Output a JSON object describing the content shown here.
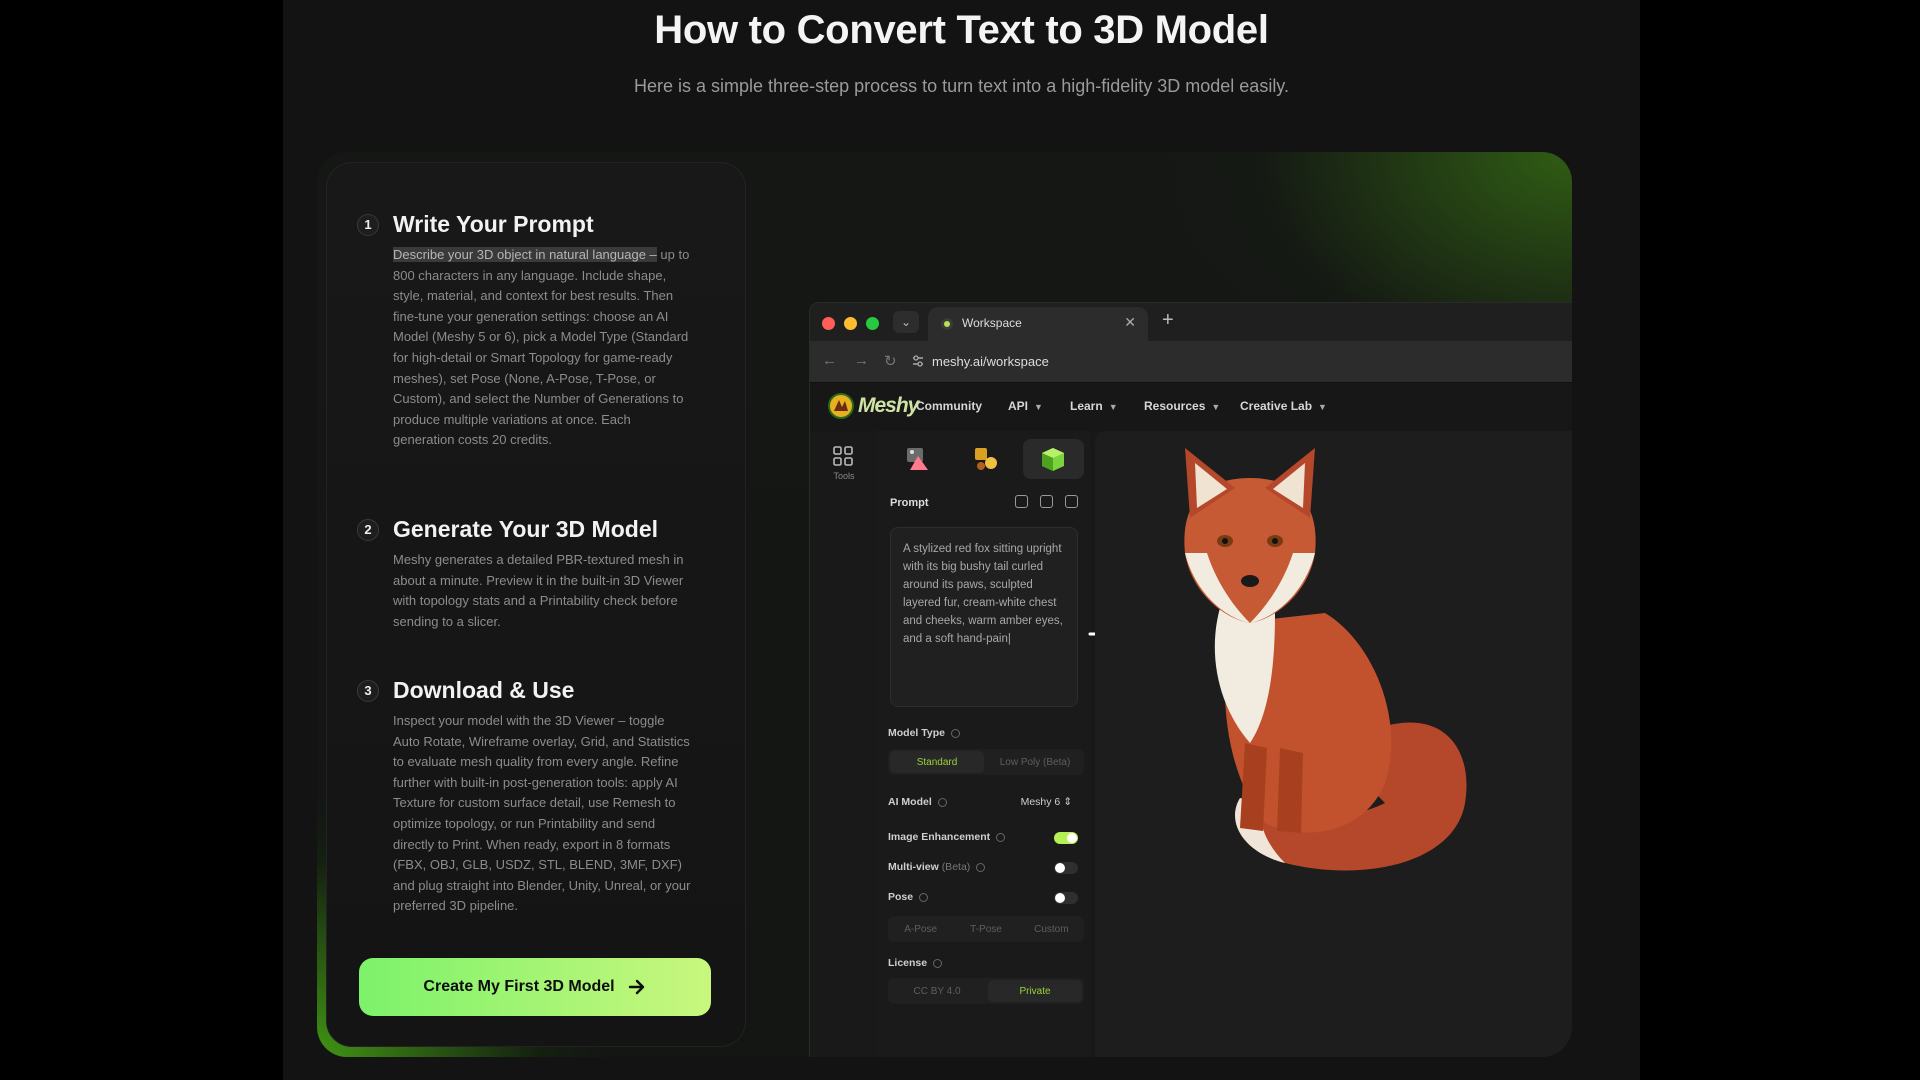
{
  "header": {
    "title": "How to Convert Text to 3D Model",
    "subtitle": "Here is a simple three-step process to turn text into a high-fidelity 3D model easily."
  },
  "steps": [
    {
      "number": "1",
      "title": "Write Your Prompt",
      "desc_highlight": "Describe your 3D object in natural language –",
      "desc": " up to 800 characters in any language. Include shape, style, material, and context for best results. Then fine-tune your generation settings: choose an AI Model (Meshy 5 or 6), pick a Model Type (Standard for high-detail or Smart Topology for game-ready meshes), set Pose (None, A-Pose, T-Pose, or Custom), and select the Number of Generations to produce multiple variations at once. Each generation costs 20 credits."
    },
    {
      "number": "2",
      "title": "Generate Your 3D Model",
      "desc": "Meshy generates a detailed PBR-textured mesh in about a minute. Preview it in the built-in 3D Viewer with topology stats and a Printability check before sending to a slicer."
    },
    {
      "number": "3",
      "title": "Download & Use",
      "desc": "Inspect your model with the 3D Viewer – toggle Auto Rotate, Wireframe overlay, Grid, and Statistics to evaluate mesh quality from every angle. Refine further with built-in post-generation tools: apply AI Texture for custom surface detail, use Remesh to optimize topology, or run Printability and send directly to Print. When ready, export in 8 formats (FBX, OBJ, GLB, USDZ, STL, BLEND, 3MF, DXF) and plug straight into Blender, Unity, Unreal, or your preferred 3D pipeline."
    }
  ],
  "cta": {
    "label": "Create My First 3D Model"
  },
  "browser": {
    "tab_title": "Workspace",
    "url": "meshy.ai/workspace"
  },
  "app": {
    "logo_text": "Meshy",
    "nav": [
      {
        "label": "Community",
        "has_caret": false
      },
      {
        "label": "API",
        "has_caret": true
      },
      {
        "label": "Learn",
        "has_caret": true
      },
      {
        "label": "Resources",
        "has_caret": true
      },
      {
        "label": "Creative Lab",
        "has_caret": true
      }
    ],
    "rail_label": "Tools",
    "prompt_label": "Prompt",
    "prompt_text": "A stylized red fox sitting upright with its big bushy tail curled around its paws, sculpted layered fur, cream-white chest and cheeks, warm amber eyes, and a soft hand-pain|",
    "model_type": {
      "label": "Model Type",
      "options": [
        "Standard",
        "Low Poly (Beta)"
      ],
      "selected": "Standard"
    },
    "ai_model": {
      "label": "AI Model",
      "value": "Meshy 6"
    },
    "image_enhancement": {
      "label": "Image Enhancement",
      "on": true
    },
    "multi_view": {
      "label": "Multi-view",
      "beta": "(Beta)",
      "on": false
    },
    "pose": {
      "label": "Pose",
      "on": false,
      "options": [
        "A-Pose",
        "T-Pose",
        "Custom"
      ]
    },
    "license": {
      "label": "License",
      "options": [
        "CC BY 4.0",
        "Private"
      ],
      "selected": "Private"
    }
  },
  "colors": {
    "accent_green": "#9bd23a",
    "cta_start": "#7cf26a",
    "cta_end": "#c9f77e"
  }
}
